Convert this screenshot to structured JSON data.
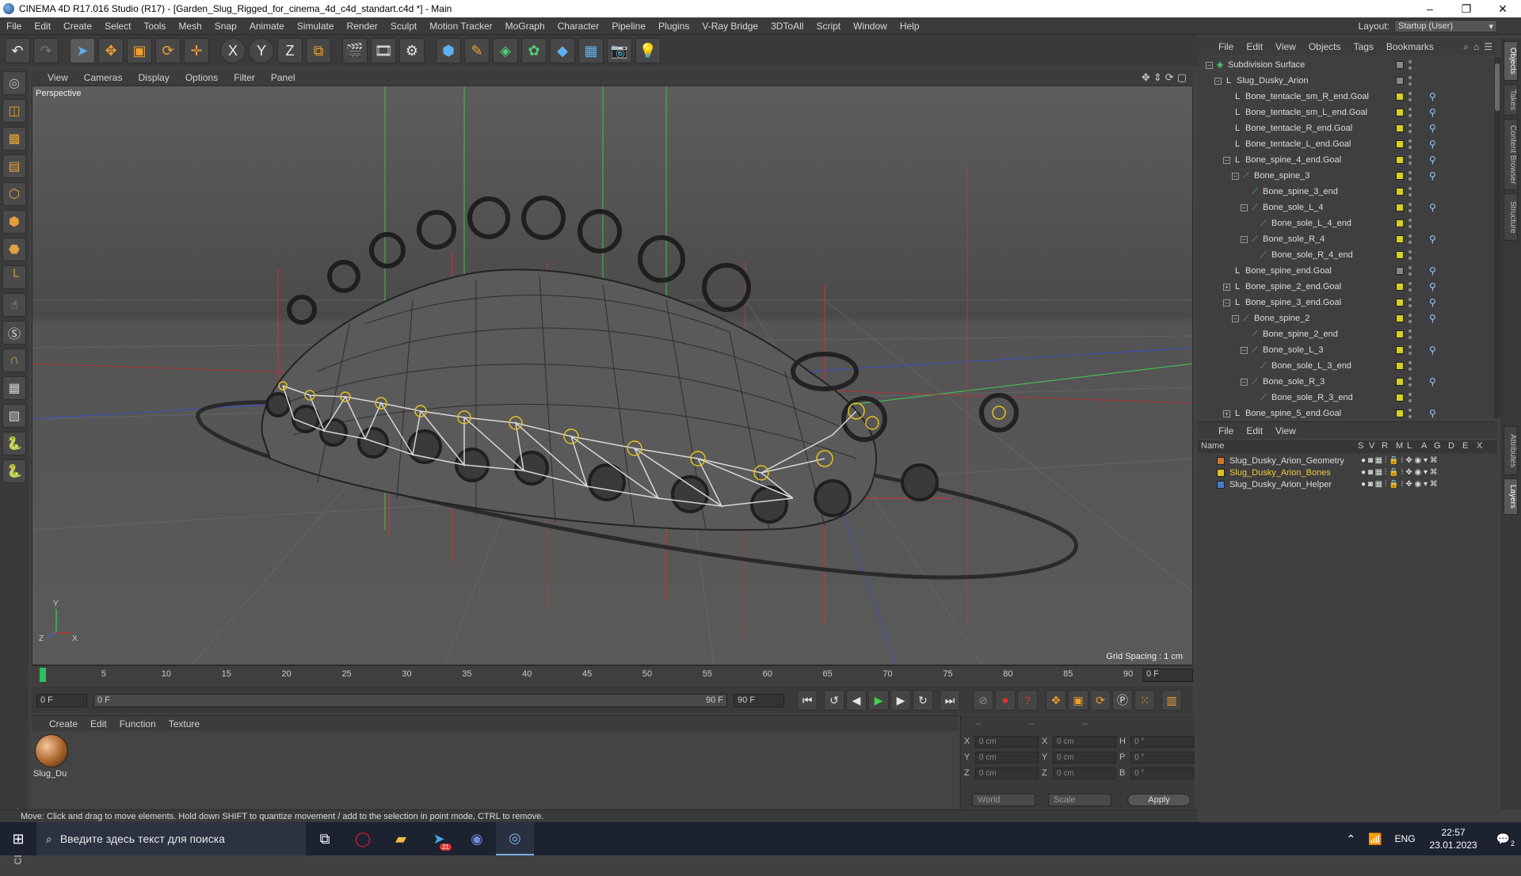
{
  "window": {
    "title": "CINEMA 4D R17.016 Studio (R17) - [Garden_Slug_Rigged_for_cinema_4d_c4d_standart.c4d *] - Main",
    "controls": [
      "–",
      "❐",
      "✕"
    ]
  },
  "menu": {
    "items": [
      "File",
      "Edit",
      "Create",
      "Select",
      "Tools",
      "Mesh",
      "Snap",
      "Animate",
      "Simulate",
      "Render",
      "Sculpt",
      "Motion Tracker",
      "MoGraph",
      "Character",
      "Pipeline",
      "Plugins",
      "V-Ray Bridge",
      "3DToAll",
      "Script",
      "Window",
      "Help"
    ],
    "layout_label": "Layout:",
    "layout_value": "Startup (User)"
  },
  "toolbar": {
    "icons": [
      "undo-icon",
      "redo-icon",
      "select-arrow-icon",
      "move-icon",
      "scale-icon",
      "rotate-icon",
      "live-select-icon",
      "axis-x-icon",
      "axis-y-icon",
      "axis-z-icon",
      "coordinate-system-icon",
      "render-view-icon",
      "render-picture-viewer-icon",
      "edit-render-settings-icon",
      "cube-icon",
      "pen-spline-icon",
      "subdivision-icon",
      "array-icon",
      "deformer-icon",
      "floor-icon",
      "camera-icon",
      "light-icon"
    ],
    "axis_labels": [
      "X",
      "Y",
      "Z"
    ]
  },
  "left_tools": [
    "make-editable-icon",
    "model-mode-icon",
    "texture-mode-icon",
    "workplane-icon",
    "points-mode-icon",
    "edges-mode-icon",
    "polygons-mode-icon",
    "enable-axis-icon",
    "tweak-icon",
    "snap-icon",
    "magnet-icon",
    "grid-icon",
    "workplane-lock-icon",
    "python-icon",
    "python-script-icon"
  ],
  "maxon_logo": "MAXON CINEMA 4D",
  "viewport": {
    "menu": [
      "View",
      "Cameras",
      "Display",
      "Options",
      "Filter",
      "Panel"
    ],
    "label": "Perspective",
    "grid_spacing": "Grid Spacing : 1 cm",
    "axis_labels": {
      "y": "Y",
      "z": "Z",
      "x": "X"
    }
  },
  "timeline": {
    "ticks": [
      "0",
      "5",
      "10",
      "15",
      "20",
      "25",
      "30",
      "35",
      "40",
      "45",
      "50",
      "55",
      "60",
      "65",
      "70",
      "75",
      "80",
      "85",
      "90"
    ],
    "current_frame_box": "0 F",
    "start_field": "0 F",
    "range_start": "0 F",
    "range_end": "90 F",
    "end_field": "90 F"
  },
  "material_manager": {
    "menu": [
      "Create",
      "Edit",
      "Function",
      "Texture"
    ],
    "materials": [
      {
        "name": "Slug_Du"
      }
    ]
  },
  "coordinates": {
    "header": [
      "--",
      "--",
      "--"
    ],
    "rows": [
      {
        "l1": "X",
        "v1": "0 cm",
        "l2": "X",
        "v2": "0 cm",
        "l3": "H",
        "v3": "0 °"
      },
      {
        "l1": "Y",
        "v1": "0 cm",
        "l2": "Y",
        "v2": "0 cm",
        "l3": "P",
        "v3": "0 °"
      },
      {
        "l1": "Z",
        "v1": "0 cm",
        "l2": "Z",
        "v2": "0 cm",
        "l3": "B",
        "v3": "0 °"
      }
    ],
    "mode": "World",
    "scale": "Scale",
    "apply": "Apply"
  },
  "status": "Move: Click and drag to move elements. Hold down SHIFT to quantize movement / add to the selection in point mode, CTRL to remove.",
  "object_manager": {
    "menu": [
      "File",
      "Edit",
      "View",
      "Objects",
      "Tags",
      "Bookmarks"
    ],
    "rows": [
      {
        "label": "Subdivision Surface",
        "depth": 0,
        "type": "subdiv",
        "expander": "−",
        "check": "gray",
        "tag": false
      },
      {
        "label": "Slug_Dusky_Arion",
        "depth": 1,
        "type": "null",
        "expander": "−",
        "check": "gray",
        "tag": false
      },
      {
        "label": "Bone_tentacle_sm_R_end.Goal",
        "depth": 2,
        "type": "null",
        "expander": "",
        "check": "yellow",
        "tag": true
      },
      {
        "label": "Bone_tentacle_sm_L_end.Goal",
        "depth": 2,
        "type": "null",
        "expander": "",
        "check": "yellow",
        "tag": true
      },
      {
        "label": "Bone_tentacle_R_end.Goal",
        "depth": 2,
        "type": "null",
        "expander": "",
        "check": "yellow",
        "tag": true
      },
      {
        "label": "Bone_tentacle_L_end.Goal",
        "depth": 2,
        "type": "null",
        "expander": "",
        "check": "yellow",
        "tag": true
      },
      {
        "label": "Bone_spine_4_end.Goal",
        "depth": 2,
        "type": "null",
        "expander": "−",
        "check": "yellow",
        "tag": true
      },
      {
        "label": "Bone_spine_3",
        "depth": 3,
        "type": "bone",
        "expander": "−",
        "check": "yellow",
        "tag": true
      },
      {
        "label": "Bone_spine_3_end",
        "depth": 4,
        "type": "bone",
        "expander": "",
        "check": "yellow",
        "tag": false
      },
      {
        "label": "Bone_sole_L_4",
        "depth": 4,
        "type": "bone",
        "expander": "−",
        "check": "yellow",
        "tag": true
      },
      {
        "label": "Bone_sole_L_4_end",
        "depth": 5,
        "type": "bone",
        "expander": "",
        "check": "yellow",
        "tag": false
      },
      {
        "label": "Bone_sole_R_4",
        "depth": 4,
        "type": "bone",
        "expander": "−",
        "check": "yellow",
        "tag": true
      },
      {
        "label": "Bone_sole_R_4_end",
        "depth": 5,
        "type": "bone",
        "expander": "",
        "check": "yellow",
        "tag": false
      },
      {
        "label": "Bone_spine_end.Goal",
        "depth": 2,
        "type": "null",
        "expander": "",
        "check": "gray",
        "tag": true
      },
      {
        "label": "Bone_spine_2_end.Goal",
        "depth": 2,
        "type": "null",
        "expander": "+",
        "check": "yellow",
        "tag": true
      },
      {
        "label": "Bone_spine_3_end.Goal",
        "depth": 2,
        "type": "null",
        "expander": "−",
        "check": "yellow",
        "tag": true
      },
      {
        "label": "Bone_spine_2",
        "depth": 3,
        "type": "bone",
        "expander": "−",
        "check": "yellow",
        "tag": true
      },
      {
        "label": "Bone_spine_2_end",
        "depth": 4,
        "type": "bone",
        "expander": "",
        "check": "yellow",
        "tag": false
      },
      {
        "label": "Bone_sole_L_3",
        "depth": 4,
        "type": "bone",
        "expander": "−",
        "check": "yellow",
        "tag": true
      },
      {
        "label": "Bone_sole_L_3_end",
        "depth": 5,
        "type": "bone",
        "expander": "",
        "check": "yellow",
        "tag": false
      },
      {
        "label": "Bone_sole_R_3",
        "depth": 4,
        "type": "bone",
        "expander": "−",
        "check": "yellow",
        "tag": true
      },
      {
        "label": "Bone_sole_R_3_end",
        "depth": 5,
        "type": "bone",
        "expander": "",
        "check": "yellow",
        "tag": false
      },
      {
        "label": "Bone_spine_5_end.Goal",
        "depth": 2,
        "type": "null",
        "expander": "+",
        "check": "yellow",
        "tag": true
      }
    ]
  },
  "layer_manager": {
    "menu": [
      "File",
      "Edit",
      "View"
    ],
    "columns": [
      "Name",
      "S",
      "V",
      "R",
      "M",
      "L",
      "A",
      "G",
      "D",
      "E",
      "X"
    ],
    "layers": [
      {
        "name": "Slug_Dusky_Arion_Geometry",
        "color": "#c8742c",
        "text_color": "#dcdcdc"
      },
      {
        "name": "Slug_Dusky_Arion_Bones",
        "color": "#e0c020",
        "text_color": "#f0c840"
      },
      {
        "name": "Slug_Dusky_Arion_Helper",
        "color": "#4a7ad0",
        "text_color": "#dcdcdc"
      }
    ]
  },
  "right_tabs": [
    "Objects",
    "Takes",
    "Content Browser",
    "Structure",
    "Attributes",
    "Layers"
  ],
  "taskbar": {
    "search_placeholder": "Введите здесь текст для поиска",
    "apps": [
      "task-view-icon",
      "opera-icon",
      "file-explorer-icon",
      "telegram-icon",
      "discord-icon",
      "cinema4d-icon"
    ],
    "telegram_badge": "21",
    "language": "ENG",
    "time": "22:57",
    "date": "23.01.2023",
    "notification_count": "2"
  }
}
